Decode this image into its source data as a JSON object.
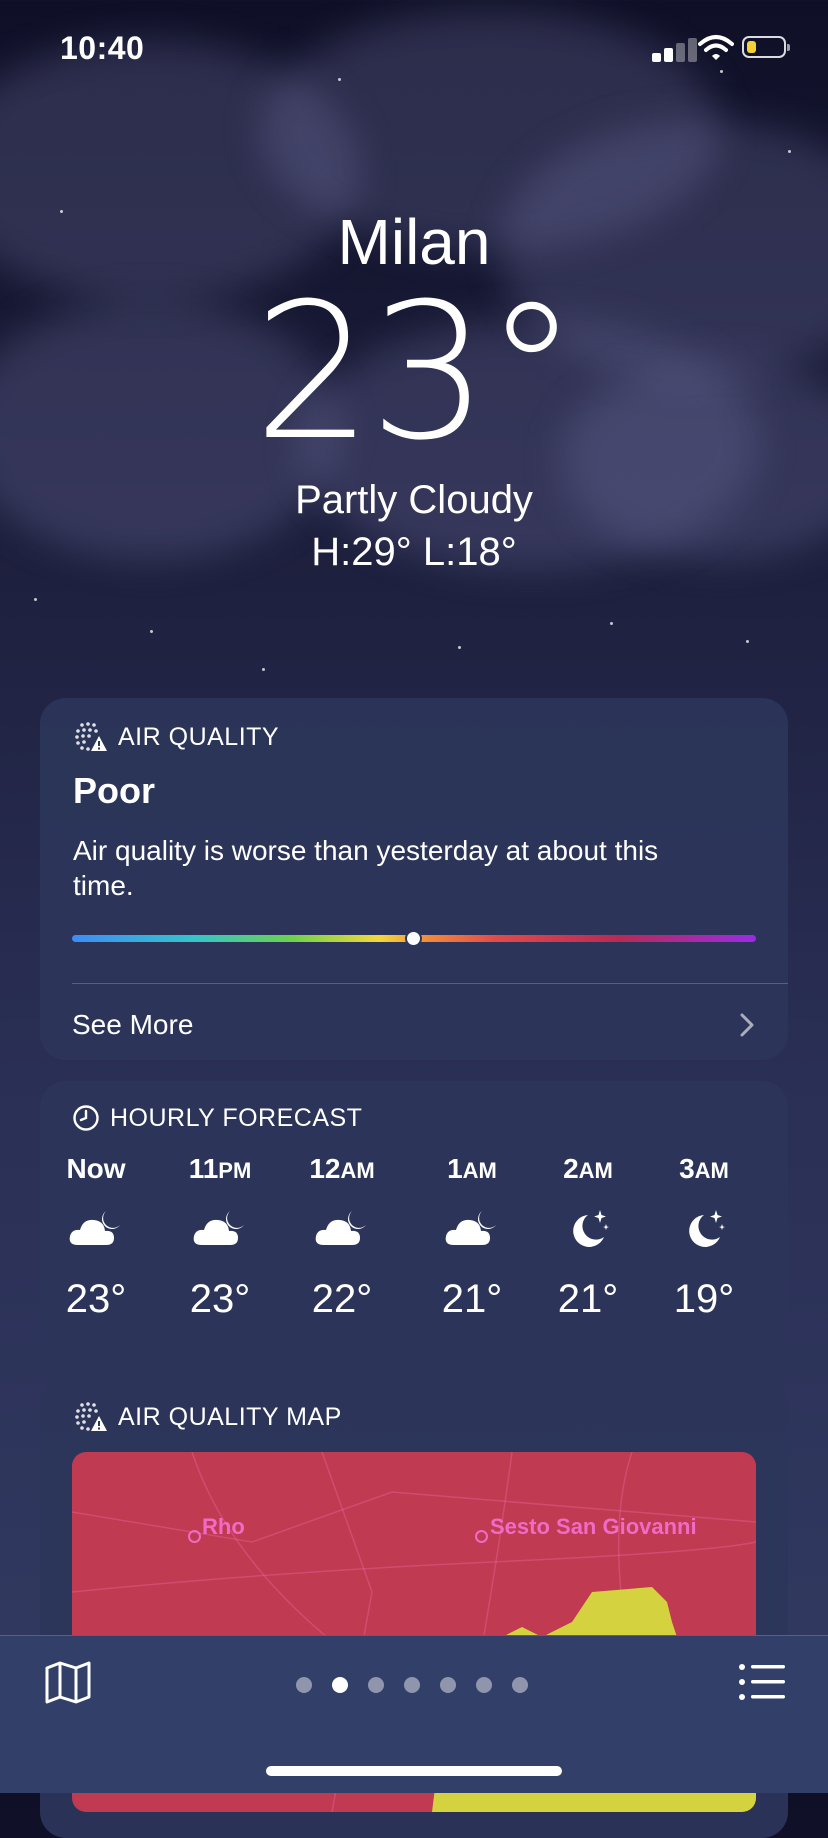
{
  "status_bar": {
    "time": "10:40"
  },
  "location": {
    "city": "Milan",
    "temperature": "23°",
    "condition": "Partly Cloudy",
    "high_low": "H:29°  L:18°"
  },
  "air_quality": {
    "header": "AIR QUALITY",
    "level": "Poor",
    "description": "Air quality is worse than yesterday at about this time.",
    "scale_position": 0.5,
    "see_more": "See More"
  },
  "hourly_forecast": {
    "header": "HOURLY FORECAST",
    "hours": [
      {
        "time": "Now",
        "suffix": "",
        "icon": "cloud-moon-icon",
        "temp": "23°"
      },
      {
        "time": "11",
        "suffix": "PM",
        "icon": "cloud-moon-icon",
        "temp": "23°"
      },
      {
        "time": "12",
        "suffix": "AM",
        "icon": "cloud-moon-icon",
        "temp": "22°"
      },
      {
        "time": "1",
        "suffix": "AM",
        "icon": "cloud-moon-icon",
        "temp": "21°"
      },
      {
        "time": "2",
        "suffix": "AM",
        "icon": "moon-stars-icon",
        "temp": "21°"
      },
      {
        "time": "3",
        "suffix": "AM",
        "icon": "moon-stars-icon",
        "temp": "19°"
      }
    ]
  },
  "air_quality_map": {
    "header": "AIR QUALITY MAP",
    "labels": [
      "Rho",
      "Sesto San Giovanni"
    ]
  },
  "pagination": {
    "count": 7,
    "active_index": 1
  },
  "colors": {
    "card": "#2c365a",
    "aqi_poor": "#c03a52",
    "aqi_moderate": "#d4d23e",
    "battery": "#f5d133"
  }
}
